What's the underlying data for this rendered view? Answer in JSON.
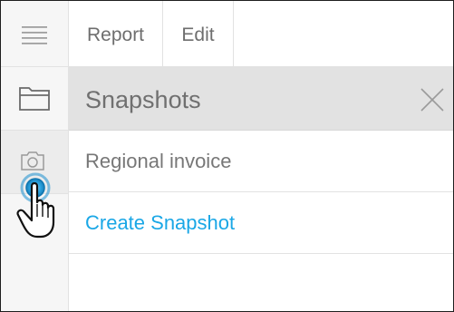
{
  "toolbar": {
    "tabs": [
      {
        "label": "Report"
      },
      {
        "label": "Edit"
      }
    ]
  },
  "rail": {
    "icons": [
      "hamburger-menu-icon",
      "folder-icon",
      "camera-icon"
    ]
  },
  "panel": {
    "title": "Snapshots",
    "close_icon": "close-icon",
    "items": [
      {
        "label": "Regional invoice"
      },
      {
        "label": "Create Snapshot"
      }
    ]
  },
  "colors": {
    "link": "#1aa7e6",
    "header_bg": "#e2e2e2",
    "text_muted": "#777777",
    "cursor_ring": "#1a9bd6"
  },
  "cursor": "hand-pointer-icon"
}
